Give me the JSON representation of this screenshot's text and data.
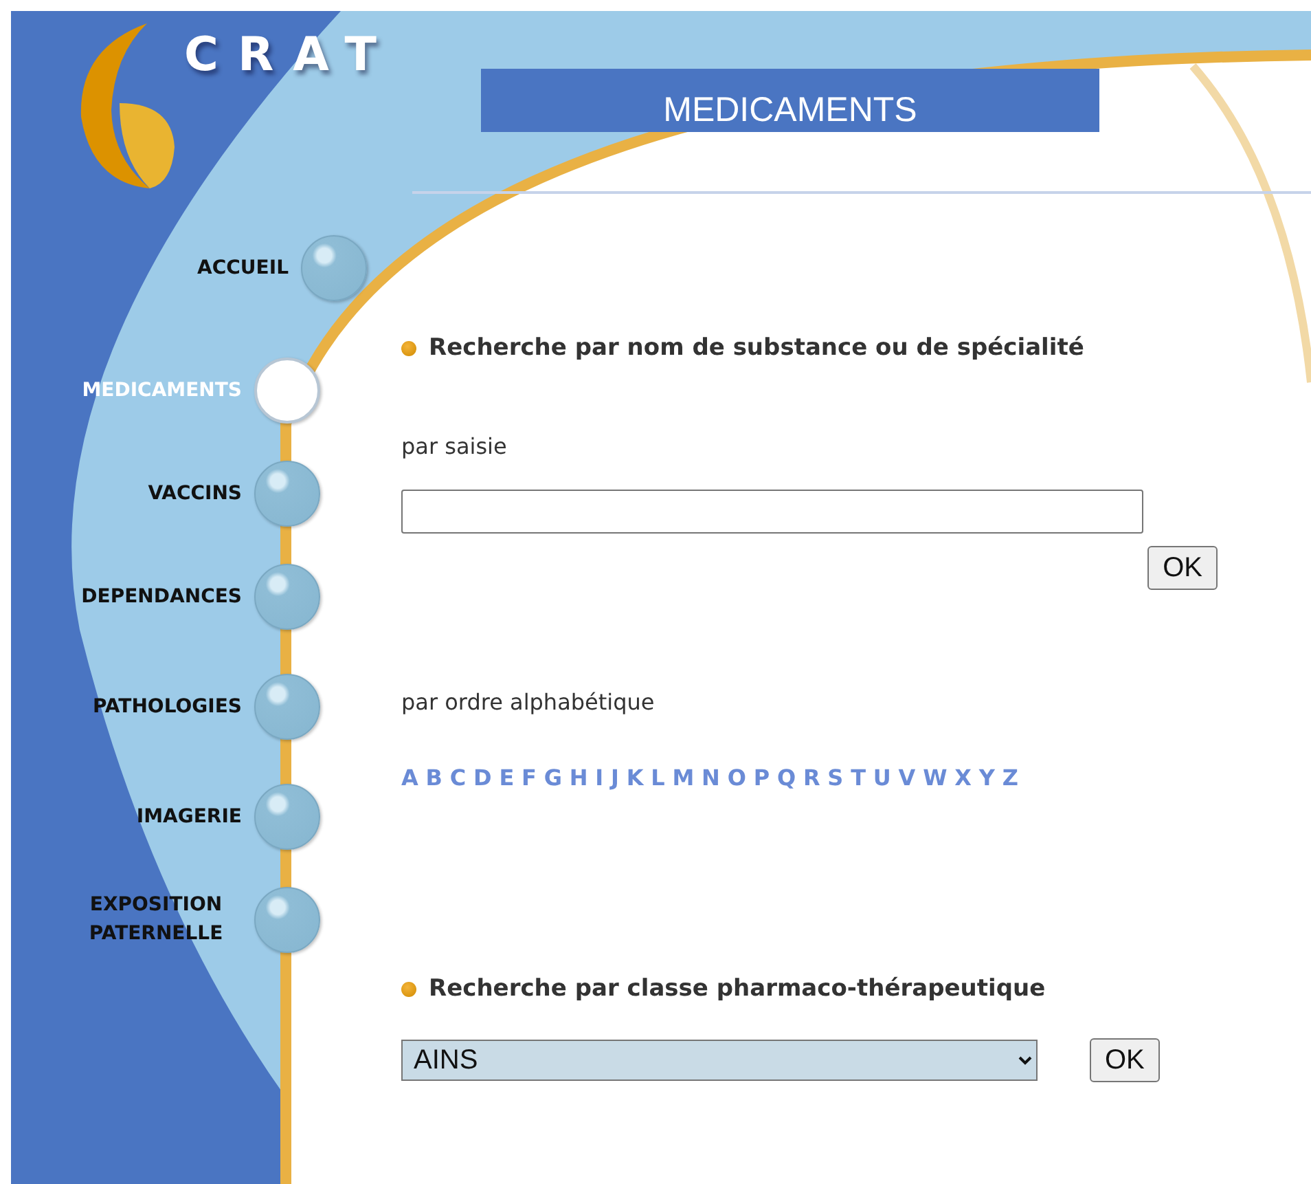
{
  "logo": {
    "text": "CRAT"
  },
  "header": {
    "title": "MEDICAMENTS"
  },
  "nav": [
    {
      "label": "ACCUEIL",
      "selected": false
    },
    {
      "label": "MEDICAMENTS",
      "selected": true
    },
    {
      "label": "VACCINS",
      "selected": false
    },
    {
      "label": "DEPENDANCES",
      "selected": false
    },
    {
      "label": "PATHOLOGIES",
      "selected": false
    },
    {
      "label": "IMAGERIE",
      "selected": false
    },
    {
      "label": "EXPOSITION PATERNELLE",
      "selected": false
    }
  ],
  "search_by_name": {
    "heading": "Recherche par nom de substance ou de spécialité",
    "by_input_label": "par saisie",
    "ok_button": "OK",
    "alphabetical_label": "par ordre alphabétique",
    "letters": [
      "A",
      "B",
      "C",
      "D",
      "E",
      "F",
      "G",
      "H",
      "I",
      "J",
      "K",
      "L",
      "M",
      "N",
      "O",
      "P",
      "Q",
      "R",
      "S",
      "T",
      "U",
      "V",
      "W",
      "X",
      "Y",
      "Z"
    ]
  },
  "search_by_class": {
    "heading": "Recherche par classe pharmaco-thérapeutique",
    "select_value": "AINS",
    "ok_button": "OK"
  }
}
